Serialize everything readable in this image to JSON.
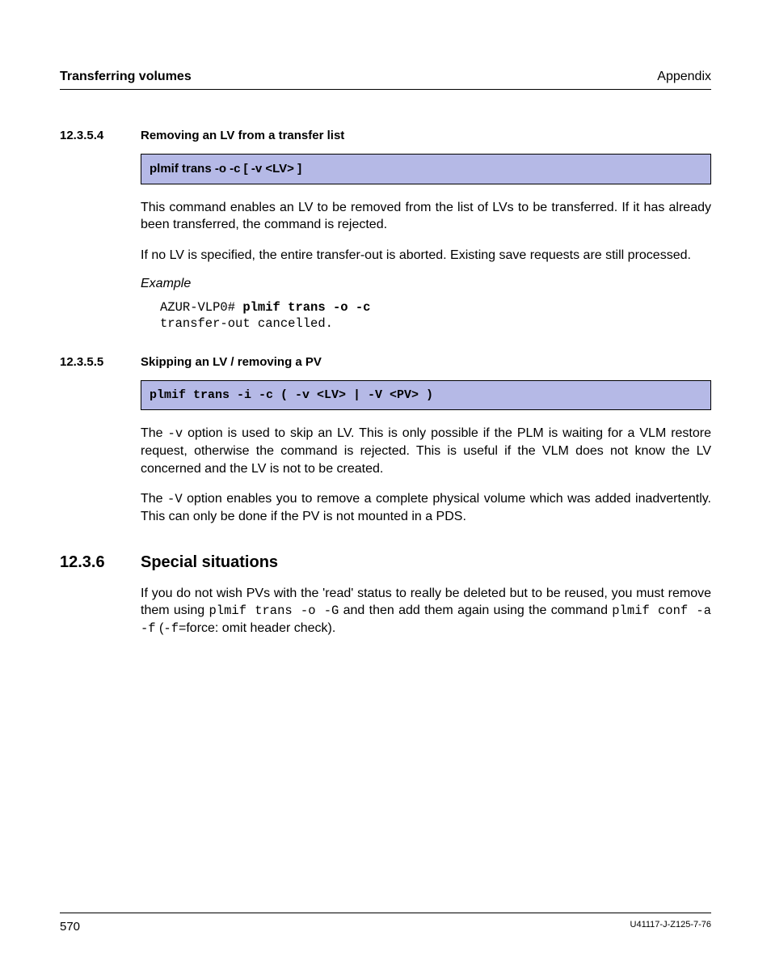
{
  "header": {
    "left": "Transferring volumes",
    "right": "Appendix"
  },
  "sec1": {
    "num": "12.3.5.4",
    "title": "Removing an LV from a transfer list",
    "cmd": "plmif trans -o -c [ -v <LV> ]",
    "p1": "This command enables an LV to be removed from the list of LVs to be transferred. If it has already been transferred, the command is rejected.",
    "p2": "If no LV is specified, the entire transfer-out is aborted. Existing save requests are still processed.",
    "example_label": "Example",
    "term_prompt": "AZUR-VLP0# ",
    "term_cmd": "plmif trans -o -c",
    "term_out": "transfer-out cancelled."
  },
  "sec2": {
    "num": "12.3.5.5",
    "title": "Skipping an LV / removing a PV",
    "cmd": "plmif trans -i -c ( -v <LV> | -V <PV> )",
    "p1a": "The ",
    "p1code": "-v",
    "p1b": " option is used to skip an LV. This is only possible if the PLM is waiting for a VLM restore request, otherwise the command is rejected. This is useful if the VLM does not know the LV concerned and the LV is not to be created.",
    "p2a": "The ",
    "p2code": "-V",
    "p2b": " option enables you to remove a complete physical volume which was added inadvertently. This can only be done if the PV is not mounted in a PDS."
  },
  "sec3": {
    "num": "12.3.6",
    "title": "Special situations",
    "p1a": "If you do not wish PVs with the 'read' status to really be deleted but to be reused, you must remove them using ",
    "p1code1": "plmif trans -o -G",
    "p1b": " and then add them again using the command ",
    "p1code2": "plmif conf -a -f",
    "p1c": " (",
    "p1code3": "-f",
    "p1d": "=force: omit header check)."
  },
  "footer": {
    "left": "570",
    "right": "U41117-J-Z125-7-76"
  }
}
